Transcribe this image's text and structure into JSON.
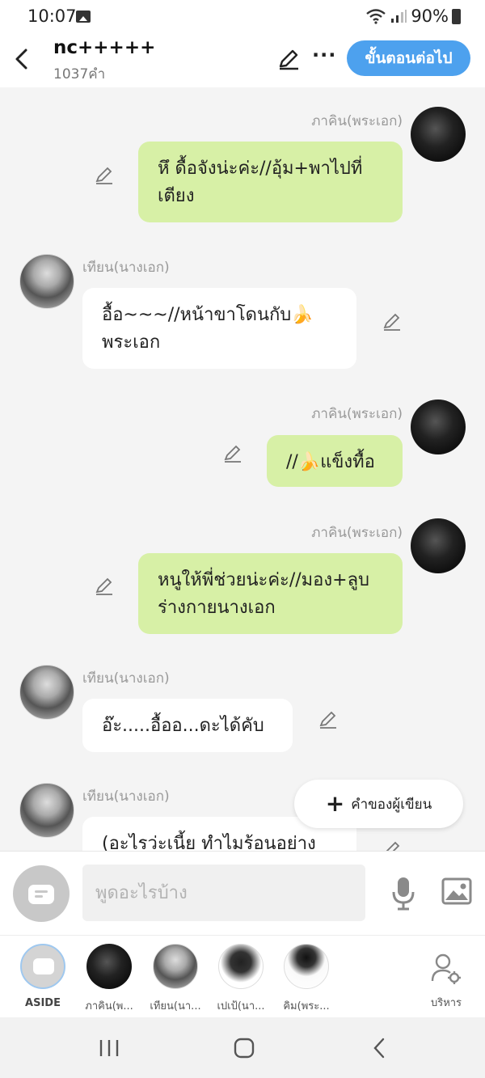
{
  "status": {
    "time": "10:07",
    "battery": "90%"
  },
  "header": {
    "title": "nc+++++",
    "word_count": "1037คำ",
    "next_label": "ขั้นตอนต่อไป"
  },
  "messages": [
    {
      "side": "right",
      "name": "ภาคิน(พระเอก)",
      "text": "หึ ดื้อจังน่ะค่ะ//อุ้ม+พาไปที่เตียง",
      "color": "green"
    },
    {
      "side": "left",
      "name": "เทียน(นางเอก)",
      "text": "อื้อ~~~//หน้าขาโดนกับ🍌พระเอก",
      "color": "white"
    },
    {
      "side": "right",
      "name": "ภาคิน(พระเอก)",
      "text": "//🍌แข็งทื้อ",
      "color": "green"
    },
    {
      "side": "right",
      "name": "ภาคิน(พระเอก)",
      "text": "หนูให้พี่ช่วยน่ะค่ะ//มอง+ลูบร่างกายนางเอก",
      "color": "green"
    },
    {
      "side": "left",
      "name": "เทียน(นางเอก)",
      "text": "อ๊ะ.....อื้ออ...ดะได้คับ",
      "color": "white"
    },
    {
      "side": "left",
      "name": "เทียน(นางเอก)",
      "text": "(อะไรว่ะเนี้ย ทำไมร้อนอย่าง",
      "color": "white"
    }
  ],
  "floating": {
    "label": "คำของผู้เขียน"
  },
  "input": {
    "placeholder": "พูดอะไรบ้าง"
  },
  "characters": [
    {
      "label": "ASIDE"
    },
    {
      "label": "ภาคิน(พ..."
    },
    {
      "label": "เทียน(นา..."
    },
    {
      "label": "เปเป้(นา..."
    },
    {
      "label": "คิม(พระ..."
    }
  ],
  "manage_label": "บริหาร",
  "colors": {
    "accent": "#4da1ee",
    "green_bubble": "#d7f0a6",
    "background": "#f4f4f4"
  }
}
